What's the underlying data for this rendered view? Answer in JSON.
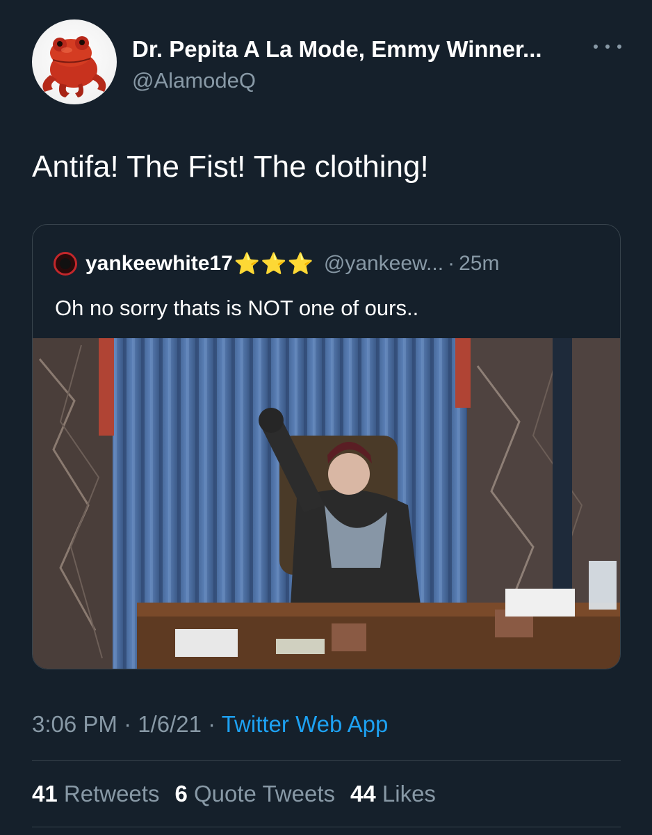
{
  "author": {
    "display_name": "Dr. Pepita A La Mode, Emmy Winner...",
    "handle": "@AlamodeQ",
    "avatar_icon": "red-frog-avatar"
  },
  "tweet": {
    "text": "Antifa! The Fist! The clothing!"
  },
  "quoted_tweet": {
    "name": "yankeewhite17",
    "stars": "⭐⭐⭐",
    "handle": "@yankeew...",
    "separator": "·",
    "time": "25m",
    "text": "Oh no sorry thats is NOT one of ours..",
    "media_icon": "photo-person-raising-fist-at-desk"
  },
  "meta": {
    "time": "3:06 PM",
    "sep1": " · ",
    "date": "1/6/21",
    "sep2": " · ",
    "source": "Twitter Web App"
  },
  "stats": {
    "retweets_count": "41",
    "retweets_label": "Retweets",
    "quotes_count": "6",
    "quotes_label": "Quote Tweets",
    "likes_count": "44",
    "likes_label": "Likes"
  },
  "colors": {
    "background": "#15202b",
    "secondary_text": "#8899a6",
    "link": "#1da1f2",
    "border": "#38444d"
  }
}
